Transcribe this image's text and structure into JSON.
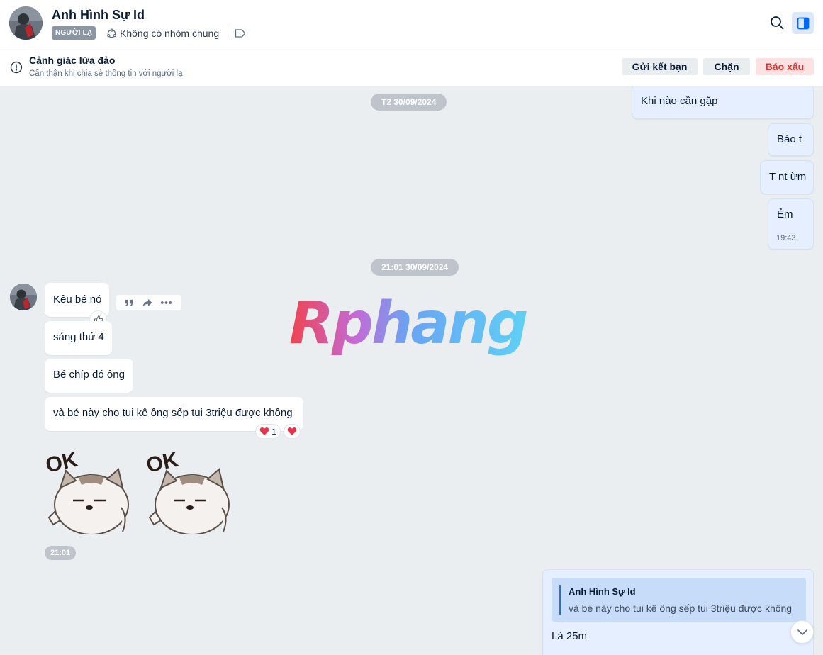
{
  "header": {
    "contact_name": "Anh Hình Sự Id",
    "stranger_badge": "NGƯỜI LẠ",
    "groups_label": "Không có nhóm chung"
  },
  "warning": {
    "title": "Cảnh giác lừa đảo",
    "subtitle": "Cẩn thận khi chia sẻ thông tin với người lạ",
    "add_friend_label": "Gửi kết bạn",
    "block_label": "Chặn",
    "report_label": "Báo xấu"
  },
  "chat": {
    "date_1": "T2 30/09/2024",
    "date_2": "21:01 30/09/2024",
    "outgoing_top": [
      {
        "text": "Khi nào cần gặp"
      },
      {
        "text": "Báo t"
      },
      {
        "text": "T nt ừm"
      },
      {
        "text": "Ẻm",
        "time": "19:43"
      }
    ],
    "incoming": [
      {
        "text": "Kêu bé nó"
      },
      {
        "text": "sáng thứ 4"
      },
      {
        "text": "Bé chíp đó ông"
      },
      {
        "text": "và bé này cho tui kê ông sếp tui 3triệu được không"
      }
    ],
    "reaction_count": "1",
    "stickers": [
      {
        "text": "OK"
      },
      {
        "text": "OK"
      }
    ],
    "sticker_time": "21:01",
    "watermark": "Rphang",
    "reply": {
      "quote_name": "Anh Hình Sự Id",
      "quote_text": "và bé này cho tui kê ông sếp tui 3triệu được không",
      "text": "Là 25m"
    }
  },
  "colors": {
    "accent": "#0068ff",
    "outgoing_bubble": "#e5efff",
    "report": "#db342e"
  },
  "icons": [
    "search-icon",
    "sidebar-panel-icon",
    "groups-icon",
    "tag-icon",
    "alert-icon",
    "quote-icon",
    "share-icon",
    "more-icon",
    "like-icon",
    "heart-icon",
    "chevron-down-icon"
  ]
}
